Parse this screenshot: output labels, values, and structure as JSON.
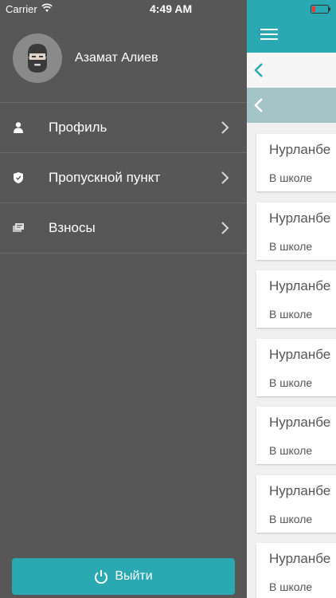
{
  "status_bar": {
    "carrier": "Carrier",
    "time": "4:49 AM",
    "battery_color": "#e53935"
  },
  "user": {
    "name": "Азамат Алиев"
  },
  "menu": [
    {
      "label": "Профиль",
      "icon": "person-icon"
    },
    {
      "label": "Пропускной пункт",
      "icon": "shield-icon"
    },
    {
      "label": "Взносы",
      "icon": "payments-icon"
    }
  ],
  "logout": {
    "label": "Выйти",
    "icon": "power-icon"
  },
  "main": {
    "cards": [
      {
        "name": "Нурланбе",
        "status": "В школе"
      },
      {
        "name": "Нурланбе",
        "status": "В школе"
      },
      {
        "name": "Нурланбе",
        "status": "В школе"
      },
      {
        "name": "Нурланбе",
        "status": "В школе"
      },
      {
        "name": "Нурланбе",
        "status": "В школе"
      },
      {
        "name": "Нурланбе",
        "status": "В школе"
      },
      {
        "name": "Нурланбе",
        "status": "В школе"
      }
    ]
  },
  "colors": {
    "accent": "#2aa9b3",
    "drawer": "#575757",
    "back_bar": "#a4c3c7"
  }
}
